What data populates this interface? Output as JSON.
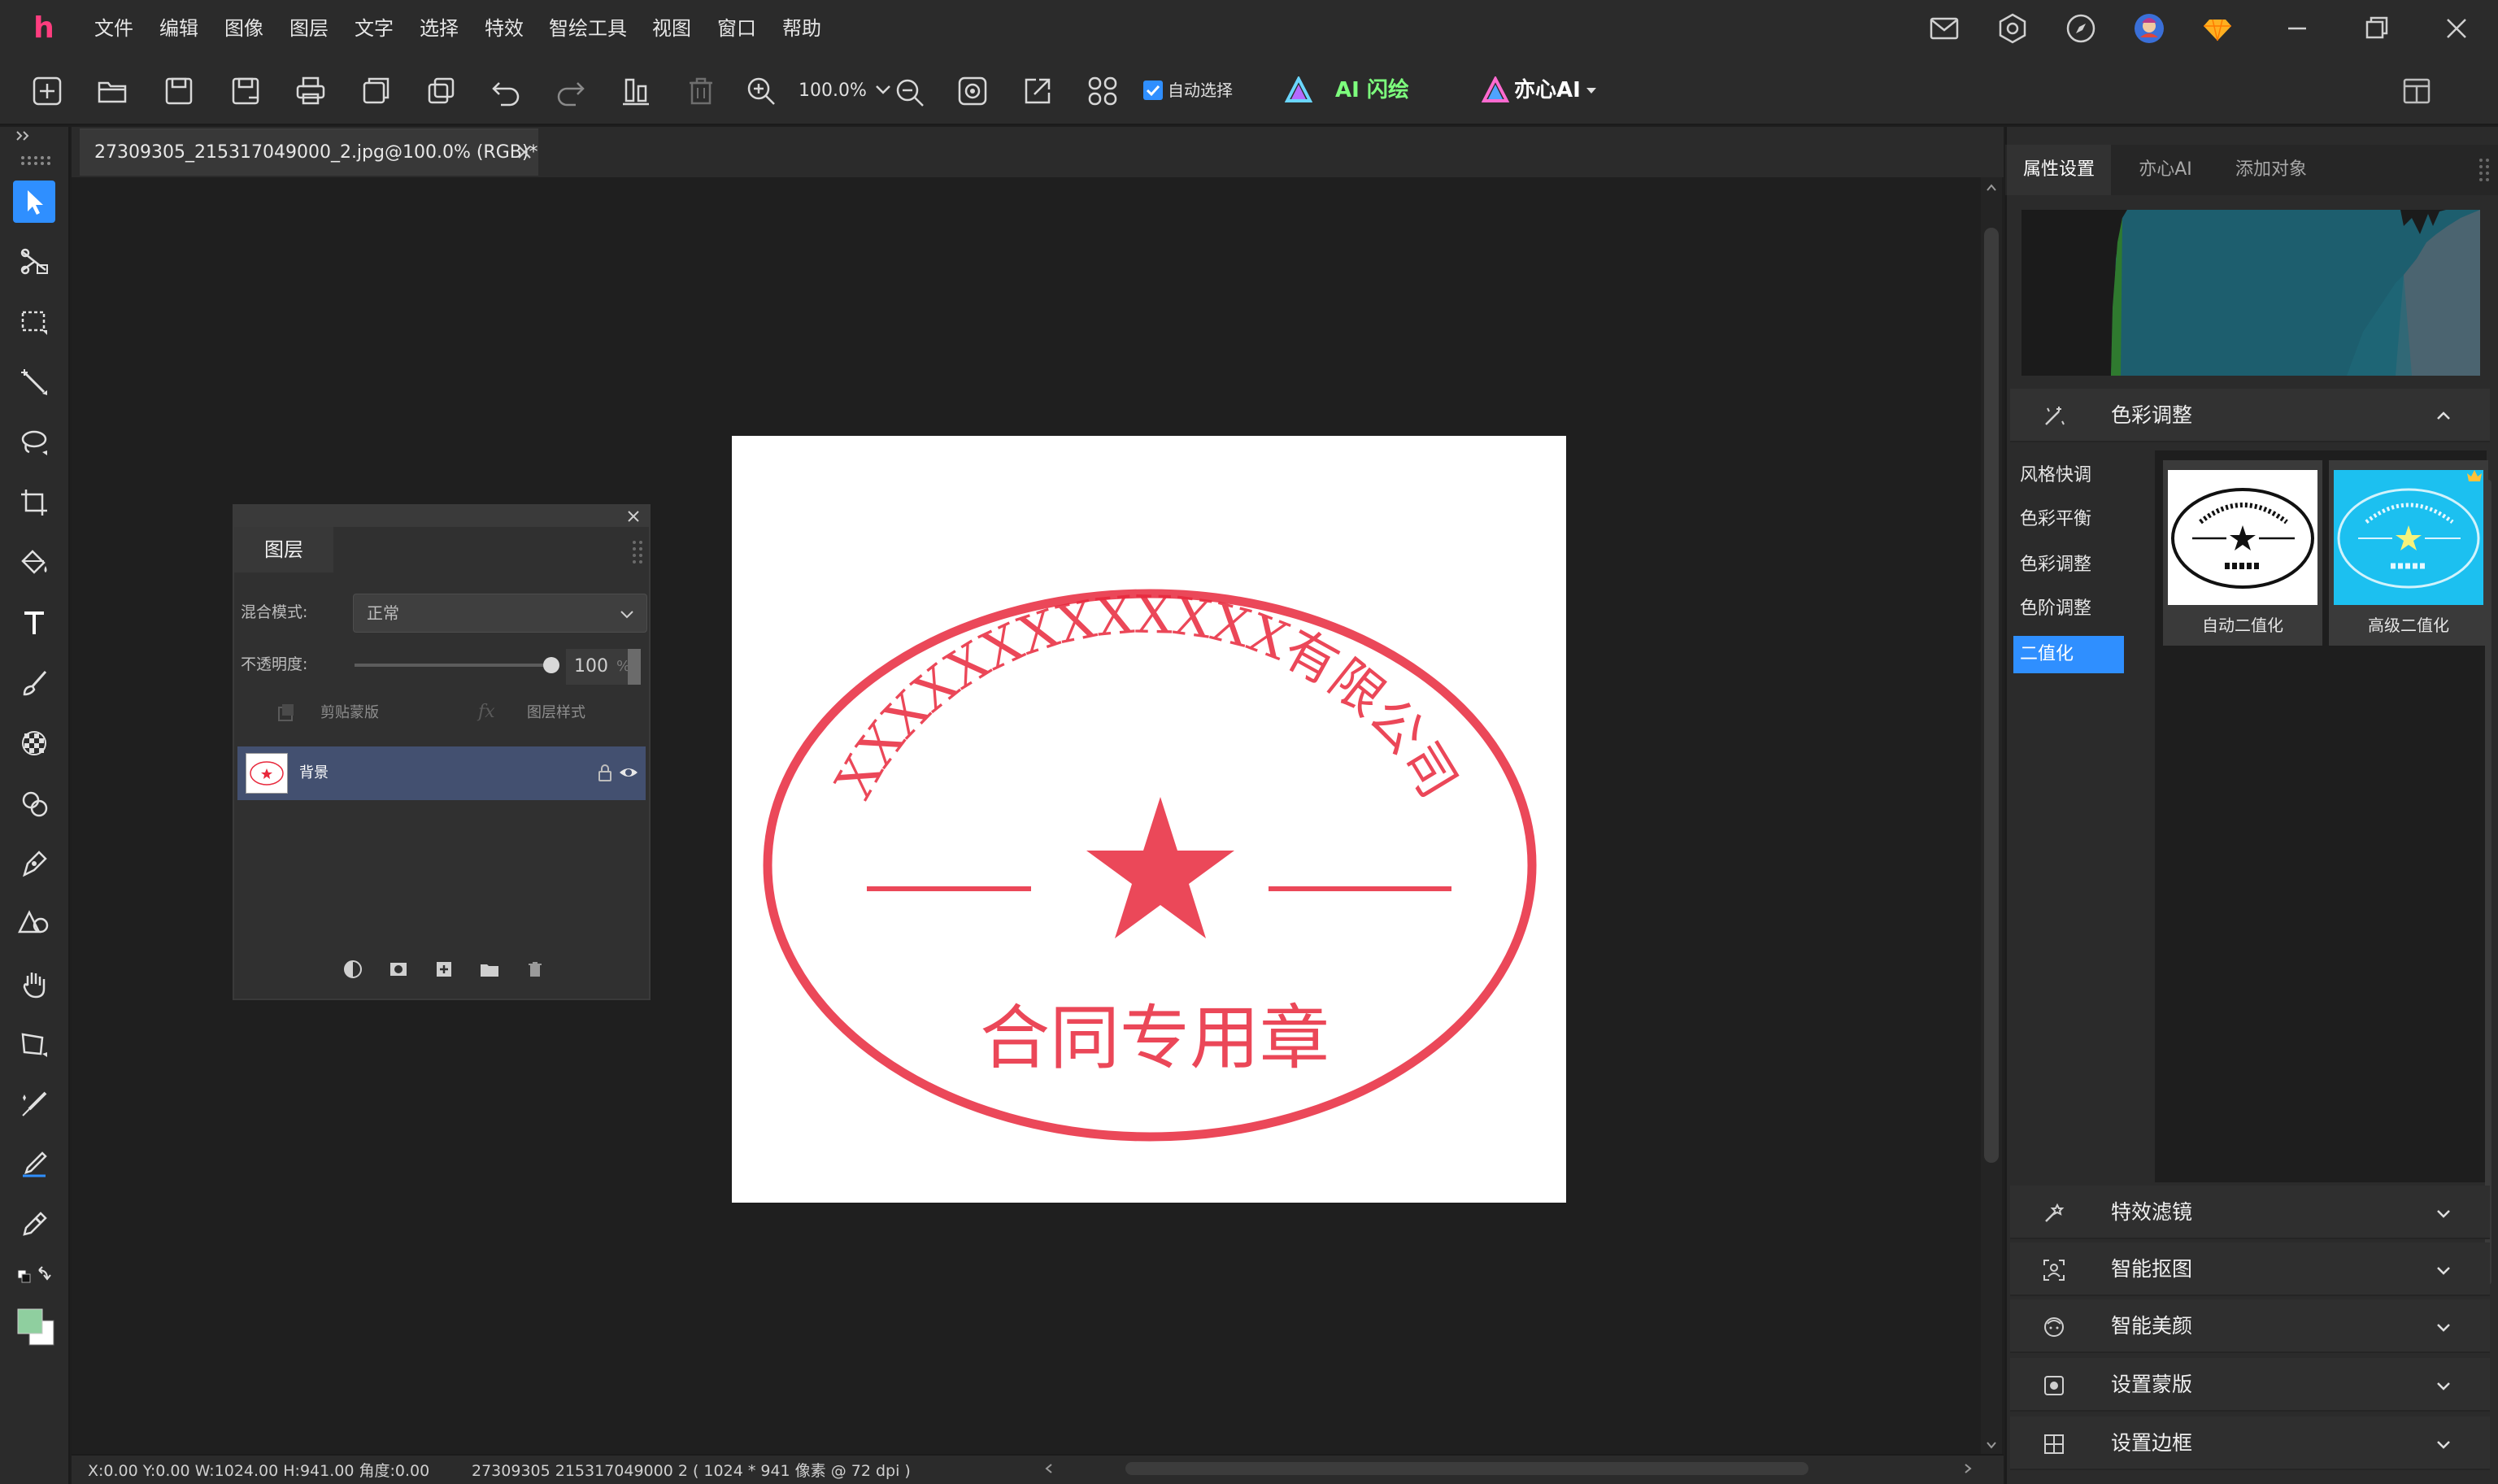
{
  "menu": {
    "logo": "h",
    "items": [
      "文件",
      "编辑",
      "图像",
      "图层",
      "文字",
      "选择",
      "特效",
      "智绘工具",
      "视图",
      "窗口",
      "帮助"
    ]
  },
  "window_icons": [
    "mail-icon",
    "settings-hex-icon",
    "compass-icon",
    "user-avatar",
    "gem-icon",
    "minimize-icon",
    "restore-icon",
    "close-icon"
  ],
  "toolbar": {
    "zoom": "100.0%",
    "auto_select_label": "自动选择",
    "auto_select_checked": true,
    "ai_flash_label": "AI 闪绘",
    "yixin_ai_label": "亦心AI"
  },
  "document": {
    "tab_title": "27309305_215317049000_2.jpg@100.0% (RGB)*"
  },
  "status": {
    "coords": "X:0.00 Y:0.00 W:1024.00 H:941.00 角度:0.00",
    "info": "27309305  215317049000  2 ( 1024 * 941 像素 @ 72 dpi )"
  },
  "layers_panel": {
    "tab": "图层",
    "blend_label": "混合模式:",
    "blend_value": "正常",
    "opacity_label": "不透明度:",
    "opacity_value": "100",
    "opacity_unit": "%",
    "clip_mask": "剪贴蒙版",
    "layer_style": "图层样式",
    "layer_name": "背景"
  },
  "stamp": {
    "arc_text": "XXXXXXXXXXXXX有限公司",
    "bottom_text": "合同专用章",
    "color": "#e8283c"
  },
  "right_panel": {
    "tabs": [
      "属性设置",
      "亦心AI",
      "添加对象"
    ],
    "color_adjust_title": "色彩调整",
    "adjust_items": [
      "风格快调",
      "色彩平衡",
      "色彩调整",
      "色阶调整",
      "二值化"
    ],
    "presets": [
      "自动二值化",
      "高级二值化"
    ],
    "sections": [
      "特效滤镜",
      "智能抠图",
      "智能美颜",
      "设置蒙版",
      "设置边框"
    ]
  },
  "colors": {
    "accent": "#2f8fff",
    "background": "#1e1e1e",
    "panel": "#2b2b2b"
  }
}
